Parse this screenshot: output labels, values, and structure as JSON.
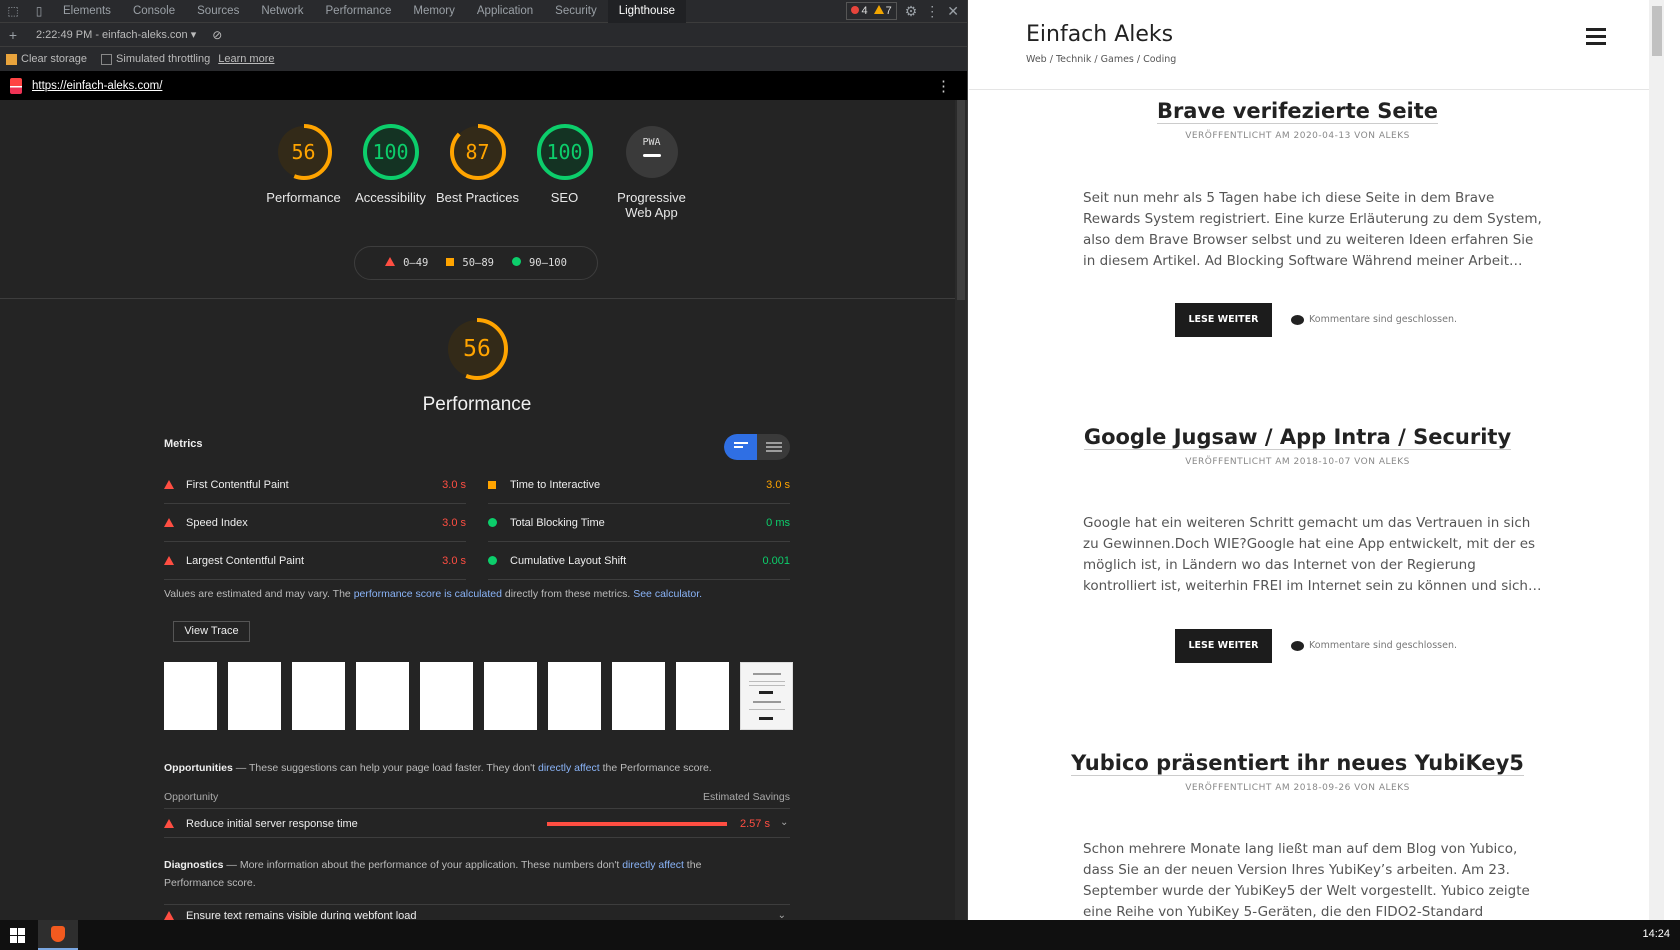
{
  "devtools": {
    "tabs": [
      "Elements",
      "Console",
      "Sources",
      "Network",
      "Performance",
      "Memory",
      "Application",
      "Security",
      "Lighthouse"
    ],
    "active_tab": "Lighthouse",
    "errors": "4",
    "warnings": "7",
    "report_select": "2:22:49 PM - einfach-aleks.con",
    "clear_storage": "Clear storage",
    "simulated_throttling": "Simulated throttling",
    "learn_more": "Learn more",
    "url": "https://einfach-aleks.com/",
    "categories": [
      {
        "score": "56",
        "label": "Performance",
        "value": 56,
        "color": "#ffa400"
      },
      {
        "score": "100",
        "label": "Accessibility",
        "value": 100,
        "color": "#0cce6b"
      },
      {
        "score": "87",
        "label": "Best Practices",
        "value": 87,
        "color": "#ffa400"
      },
      {
        "score": "100",
        "label": "SEO",
        "value": 100,
        "color": "#0cce6b"
      },
      {
        "score": "PWA",
        "label": "Progressive Web App",
        "value": 0,
        "color": "#9aa0a6"
      }
    ],
    "legend": {
      "low": "0–49",
      "mid": "50–89",
      "high": "90–100"
    },
    "perf": {
      "score": "56",
      "value": 56,
      "title": "Performance",
      "metrics_label": "Metrics",
      "metrics": [
        {
          "name": "First Contentful Paint",
          "value": "3.0 s",
          "status": "red"
        },
        {
          "name": "Time to Interactive",
          "value": "3.0 s",
          "status": "orange"
        },
        {
          "name": "Speed Index",
          "value": "3.0 s",
          "status": "red"
        },
        {
          "name": "Total Blocking Time",
          "value": "0 ms",
          "status": "green"
        },
        {
          "name": "Largest Contentful Paint",
          "value": "3.0 s",
          "status": "red"
        },
        {
          "name": "Cumulative Layout Shift",
          "value": "0.001",
          "status": "green"
        }
      ],
      "note_a": "Values are estimated and may vary. The ",
      "note_link1": "performance score is calculated",
      "note_b": " directly from these metrics. ",
      "note_link2": "See calculator.",
      "view_trace": "View Trace",
      "opp_title": "Opportunities",
      "opp_text": " — These suggestions can help your page load faster. They don't ",
      "opp_link": "directly affect",
      "opp_tail": " the Performance score.",
      "opp_col1": "Opportunity",
      "opp_col2": "Estimated Savings",
      "opp_row": "Reduce initial server response time",
      "opp_savings": "2.57 s",
      "diag_title": "Diagnostics",
      "diag_text": " — More information about the performance of your application. These numbers don't ",
      "diag_link": "directly affect",
      "diag_tail": " the Performance score.",
      "diag_row": "Ensure text remains visible during webfont load"
    }
  },
  "site": {
    "title": "Einfach Aleks",
    "tagline": "Web / Technik / Games / Coding",
    "posts": [
      {
        "title": "Brave verifezierte Seite",
        "meta": "VERÖFFENTLICHT AM 2020-04-13 VON ALEKS",
        "excerpt": "Seit nun mehr als 5 Tagen habe ich diese Seite in dem Brave Rewards System registriert. Eine kurze Erläuterung zu dem System, also dem Brave Browser selbst und zu weiteren Ideen erfahren Sie in diesem Artikel. Ad Blocking Software Während meiner Arbeit…",
        "button": "LESE WEITER",
        "comments": "Kommentare sind geschlossen."
      },
      {
        "title": "Google Jugsaw / App Intra / Security",
        "meta": "VERÖFFENTLICHT AM 2018-10-07 VON ALEKS",
        "excerpt": "Google hat ein weiteren Schritt gemacht um das Vertrauen in sich zu Gewinnen.Doch WIE?Google hat eine App entwickelt, mit der es möglich ist, in Ländern wo das Internet von der Regierung kontrolliert ist, weiterhin FREI im Internet sein zu können und sich…",
        "button": "LESE WEITER",
        "comments": "Kommentare sind geschlossen."
      },
      {
        "title": "Yubico präsentiert ihr neues YubiKey5",
        "meta": "VERÖFFENTLICHT AM 2018-09-26 VON ALEKS",
        "excerpt": "Schon mehrere Monate lang ließt man auf dem Blog von Yubico, dass Sie an der neuen Version Ihres YubiKey’s arbeiten. Am 23. September wurde der YubiKey5 der Welt vorgestellt. Yubico zeigte eine Reihe von YubiKey 5-Geräten, die den FIDO2-Standard"
      }
    ]
  },
  "taskbar": {
    "time": "14:24"
  }
}
